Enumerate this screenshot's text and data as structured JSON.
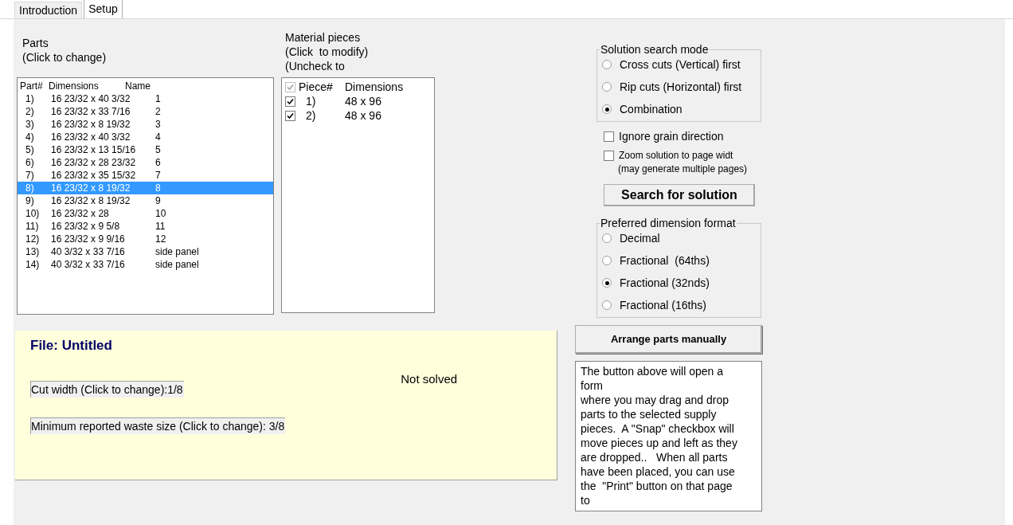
{
  "tabs": [
    {
      "label": "Introduction",
      "selected": false
    },
    {
      "label": "Setup",
      "selected": true
    }
  ],
  "parts": {
    "title_lines": [
      "Parts",
      "(Click to change)"
    ],
    "columns": [
      "Part#",
      "Dimensions",
      "Name"
    ],
    "rows": [
      {
        "num": "1)",
        "dims": "16 23/32 x 40 3/32",
        "name": "1",
        "selected": false
      },
      {
        "num": "2)",
        "dims": "16 23/32 x 33 7/16",
        "name": "2",
        "selected": false
      },
      {
        "num": "3)",
        "dims": "16 23/32 x 8 19/32",
        "name": "3",
        "selected": false
      },
      {
        "num": "4)",
        "dims": "16 23/32 x 40 3/32",
        "name": "4",
        "selected": false
      },
      {
        "num": "5)",
        "dims": "16 23/32 x 13 15/16",
        "name": "5",
        "selected": false
      },
      {
        "num": "6)",
        "dims": "16 23/32 x 28 23/32",
        "name": "6",
        "selected": false
      },
      {
        "num": "7)",
        "dims": "16 23/32 x 35 15/32",
        "name": "7",
        "selected": false
      },
      {
        "num": "8)",
        "dims": "16 23/32 x 8 19/32",
        "name": "8",
        "selected": true
      },
      {
        "num": "9)",
        "dims": "16 23/32 x 8 19/32",
        "name": "9",
        "selected": false
      },
      {
        "num": "10)",
        "dims": "16 23/32 x 28",
        "name": "10",
        "selected": false
      },
      {
        "num": "11)",
        "dims": "16 23/32 x 9 5/8",
        "name": "11",
        "selected": false
      },
      {
        "num": "12)",
        "dims": "16 23/32 x 9 9/16",
        "name": "12",
        "selected": false
      },
      {
        "num": "13)",
        "dims": "40 3/32 x 33 7/16",
        "name": "side panel",
        "selected": false
      },
      {
        "num": "14)",
        "dims": "40 3/32 x 33 7/16",
        "name": "side panel",
        "selected": false
      }
    ]
  },
  "material": {
    "title_lines": [
      "Material pieces",
      "(Click  to modify)",
      "(Uncheck to"
    ],
    "header": {
      "columns": [
        "Piece#",
        "Dimensions"
      ],
      "checked": true,
      "disabled": true
    },
    "rows": [
      {
        "num": "1)",
        "dims": "48 x 96",
        "checked": true
      },
      {
        "num": "2)",
        "dims": "48 x 96",
        "checked": true
      }
    ]
  },
  "search_mode": {
    "title": "Solution search mode",
    "options": [
      {
        "label": "Cross cuts (Vertical) first",
        "selected": false
      },
      {
        "label": "Rip cuts (Horizontal) first",
        "selected": false
      },
      {
        "label": "Combination",
        "selected": true
      }
    ]
  },
  "options": [
    {
      "label": "Ignore grain direction",
      "checked": false,
      "kind": "large"
    },
    {
      "label": "Zoom solution to page widt",
      "note": "(may generate multiple pages)",
      "checked": false,
      "kind": "small"
    }
  ],
  "search_button": "Search for solution",
  "dimension_format": {
    "title": "Preferred dimension format",
    "options": [
      {
        "label": "Decimal",
        "selected": false
      },
      {
        "label": "Fractional  (64ths)",
        "selected": false
      },
      {
        "label": "Fractional (32nds)",
        "selected": true
      },
      {
        "label": "Fractional (16ths)",
        "selected": false
      }
    ]
  },
  "file_panel": {
    "title": "File: Untitled",
    "status": "Not solved",
    "cut_width": "Cut width (Click to change):1/8",
    "min_waste": "Minimum reported waste size (Click to change): 3/8"
  },
  "arrange_button": "Arrange parts manually",
  "help_text": {
    "lines": [
      "The button above will open a",
      "form",
      "where you may drag and drop",
      "parts to the selected supply",
      "pieces.  A \"Snap\" checkbox will",
      "move pieces up and left as they",
      "are dropped..   When all parts",
      "have been placed, you can use",
      "the  \"Print\" button on that page",
      "to"
    ]
  }
}
